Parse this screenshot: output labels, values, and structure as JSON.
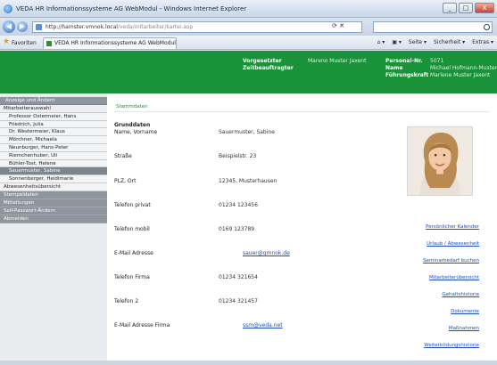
{
  "window": {
    "title": "VEDA HR Informationssysteme AG WebModul - Windows Internet Explorer",
    "minimize": "_",
    "maximize": "□",
    "close": "X"
  },
  "addressbar": {
    "url": "http://hamster.vmnok.local",
    "url_rest": "/veda/mitarbeiter/kartei.asp",
    "tools": "⟳ ✕",
    "search_placeholder": ""
  },
  "favbar": {
    "label": "Favoriten",
    "tab_title": "VEDA HR Informationssysteme AG WebModul",
    "cmd_home": "⌂ ▾",
    "cmd_feeds": "▣ ▾",
    "cmd_page": "Seite ▾",
    "cmd_safety": "Sicherheit ▾",
    "cmd_extras": "Extras ▾"
  },
  "header": {
    "deputy_label_1": "Vorgesetzter",
    "deputy_label_2": "Zeitbeauftragter",
    "deputy_name": "Mareno Muster Jaxent",
    "person_label_1": "Personal-Nr.",
    "person_label_2": "Name",
    "person_label_3": "Führungskraft",
    "person_value_1": "5071",
    "person_value_2": "Michael Hofmann-Muster",
    "person_value_3": "Marlene Muster Jaxent"
  },
  "sidebar": {
    "head": "Anzeige und Ändern",
    "items": [
      "Mitarbeiterauswahl",
      "Professor Ostermeier, Hans",
      "Friedrich, Julia",
      "Dr. Westermeier, Klaus",
      "Mörchner, Michaela",
      "Neunburger, Hans-Peter",
      "Riemchenhuber, Uli",
      "Bühler-Tost, Helene",
      "Sauermuster, Sabine",
      "Sonnenberger, Heidimarie"
    ],
    "selected_index": 8,
    "plain_item": "Abwesenheitsübersicht",
    "dark_items": [
      "Stempeldaten",
      "Mitteilungen",
      "Self-Passwort-Ändern",
      "Abmelden"
    ]
  },
  "main": {
    "crumb": "Stammdaten",
    "section_title": "Grunddaten",
    "fields": [
      {
        "label": "Name, Vorname",
        "value": "Sauermuster, Sabine",
        "link": false
      },
      {
        "label": "Straße",
        "value": "Beispielstr. 23",
        "link": false
      },
      {
        "label": "PLZ, Ort",
        "value": "12345, Musterhausen",
        "link": false
      },
      {
        "label": "Telefon privat",
        "value": "01234 123456",
        "link": false
      },
      {
        "label": "Telefon mobil",
        "value": "0169 123789",
        "link": false
      },
      {
        "label": "E-Mail Adresse",
        "value": "sauer@gmnok.de",
        "link": true
      },
      {
        "label": "Telefon Firma",
        "value": "01234 321654",
        "link": false
      },
      {
        "label": "Telefon 2",
        "value": "01234 321457",
        "link": false
      },
      {
        "label": "E-Mail Adresse Firma",
        "value": "ssm@veda.net",
        "link": true
      }
    ],
    "actions": [
      "Persönlicher Kalender",
      "Urlaub / Abwesenheit",
      "Seminarbedarf buchen",
      "Mitarbeiterübersicht",
      "Gehaltshistorie",
      "Dokumente",
      "Maßnahmen",
      "Weiterbildungshistorie"
    ]
  },
  "colors": {
    "header_green": "#19923a",
    "sidebar_selected": "#7c848c",
    "link_blue": "#1a4fb8"
  }
}
